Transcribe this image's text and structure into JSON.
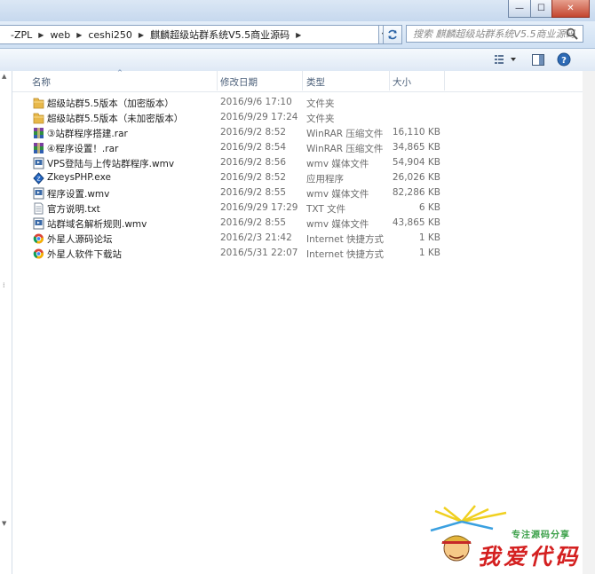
{
  "window": {
    "minimize_glyph": "—",
    "maximize_glyph": "☐",
    "close_glyph": "✕"
  },
  "address": {
    "crumbs": [
      "-ZPL",
      "web",
      "ceshi250",
      "麒麟超级站群系统V5.5商业源码"
    ],
    "search_placeholder": "搜索 麒麟超级站群系统V5.5商业源码"
  },
  "columns": {
    "name": "名称",
    "date": "修改日期",
    "type": "类型",
    "size": "大小"
  },
  "files": [
    {
      "icon": "folder-icon",
      "name": "超级站群5.5版本（加密版本）",
      "date": "2016/9/6 17:10",
      "type": "文件夹",
      "size": ""
    },
    {
      "icon": "folder-icon",
      "name": "超级站群5.5版本（未加密版本）",
      "date": "2016/9/29 17:24",
      "type": "文件夹",
      "size": ""
    },
    {
      "icon": "rar-icon",
      "name": "③站群程序搭建.rar",
      "date": "2016/9/2 8:52",
      "type": "WinRAR 压缩文件",
      "size": "16,110 KB"
    },
    {
      "icon": "rar-icon",
      "name": "④程序设置！.rar",
      "date": "2016/9/2 8:54",
      "type": "WinRAR 压缩文件",
      "size": "34,865 KB"
    },
    {
      "icon": "wmv-icon",
      "name": "VPS登陆与上传站群程序.wmv",
      "date": "2016/9/2 8:56",
      "type": "wmv 媒体文件",
      "size": "54,904 KB"
    },
    {
      "icon": "exe-icon",
      "name": "ZkeysPHP.exe",
      "date": "2016/9/2 8:52",
      "type": "应用程序",
      "size": "26,026 KB"
    },
    {
      "icon": "wmv-icon",
      "name": "程序设置.wmv",
      "date": "2016/9/2 8:55",
      "type": "wmv 媒体文件",
      "size": "82,286 KB"
    },
    {
      "icon": "txt-icon",
      "name": "官方说明.txt",
      "date": "2016/9/29 17:29",
      "type": "TXT 文件",
      "size": "6 KB"
    },
    {
      "icon": "wmv-icon",
      "name": "站群域名解析规则.wmv",
      "date": "2016/9/2 8:55",
      "type": "wmv 媒体文件",
      "size": "43,865 KB"
    },
    {
      "icon": "chrome-icon",
      "name": "外星人源码论坛",
      "date": "2016/2/3 21:42",
      "type": "Internet 快捷方式",
      "size": "1 KB"
    },
    {
      "icon": "chrome-icon",
      "name": "外星人软件下载站",
      "date": "2016/5/31 22:07",
      "type": "Internet 快捷方式",
      "size": "1 KB"
    }
  ],
  "watermark": {
    "slogan": "专注源码分享",
    "text": "我爱代码"
  },
  "colors": {
    "accent": "#3a6fb0",
    "folder": "#e8b84a",
    "watermark_red": "#d42020"
  }
}
